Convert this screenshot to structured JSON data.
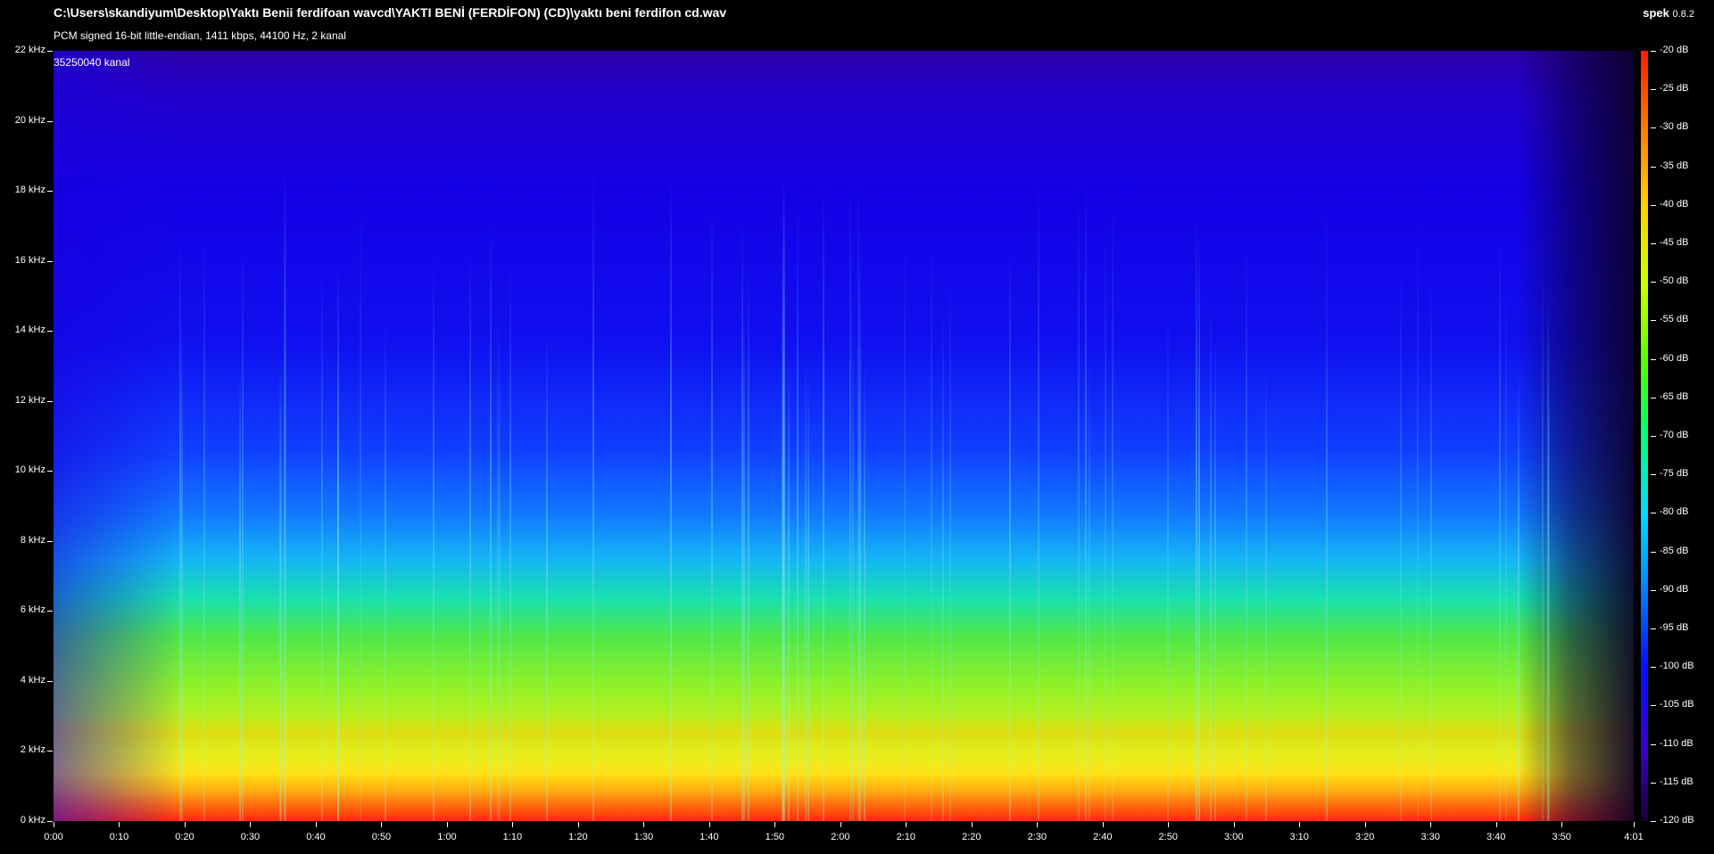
{
  "header": {
    "file_path": "C:\\Users\\skandiyum\\Desktop\\Yaktı Benii ferdifoan wavcd\\YAKTI BENİ (FERDİFON) (CD)\\yaktı beni ferdifon cd.wav",
    "audio_info": "PCM signed 16-bit little-endian, 1411 kbps, 44100 Hz, 2 kanal",
    "app_name": "spek",
    "app_version": "0.8.2"
  },
  "spectrogram": {
    "channel_label": "35250040 kanal",
    "frequency_labels": [
      "22 kHz",
      "20 kHz",
      "18 kHz",
      "16 kHz",
      "14 kHz",
      "12 kHz",
      "10 kHz",
      "8 kHz",
      "6 kHz",
      "4 kHz",
      "2 kHz",
      "0 kHz"
    ],
    "frequency_values_khz": [
      22,
      20,
      18,
      16,
      14,
      12,
      10,
      8,
      6,
      4,
      2,
      0
    ],
    "time_labels": [
      "0:00",
      "0:10",
      "0:20",
      "0:30",
      "0:40",
      "0:50",
      "1:00",
      "1:10",
      "1:20",
      "1:30",
      "1:40",
      "1:50",
      "2:00",
      "2:10",
      "2:20",
      "2:30",
      "2:40",
      "2:50",
      "3:00",
      "3:10",
      "3:20",
      "3:30",
      "3:40",
      "3:50",
      "4:01"
    ],
    "time_values_s": [
      0,
      10,
      20,
      30,
      40,
      50,
      60,
      70,
      80,
      90,
      100,
      110,
      120,
      130,
      140,
      150,
      160,
      170,
      180,
      190,
      200,
      210,
      220,
      230,
      241
    ]
  },
  "legend": {
    "db_labels": [
      "-20 dB",
      "-25 dB",
      "-30 dB",
      "-35 dB",
      "-40 dB",
      "-45 dB",
      "-50 dB",
      "-55 dB",
      "-60 dB",
      "-65 dB",
      "-70 dB",
      "-75 dB",
      "-80 dB",
      "-85 dB",
      "-90 dB",
      "-95 dB",
      "-100 dB",
      "-105 dB",
      "-110 dB",
      "-115 dB",
      "-120 dB"
    ],
    "db_values": [
      -20,
      -25,
      -30,
      -35,
      -40,
      -45,
      -50,
      -55,
      -60,
      -65,
      -70,
      -75,
      -80,
      -85,
      -90,
      -95,
      -100,
      -105,
      -110,
      -115,
      -120
    ]
  },
  "colors": {
    "background": "#000000",
    "text": "#ffffff",
    "low_energy": "#2200cc",
    "high_energy": "#ff2a0a"
  }
}
